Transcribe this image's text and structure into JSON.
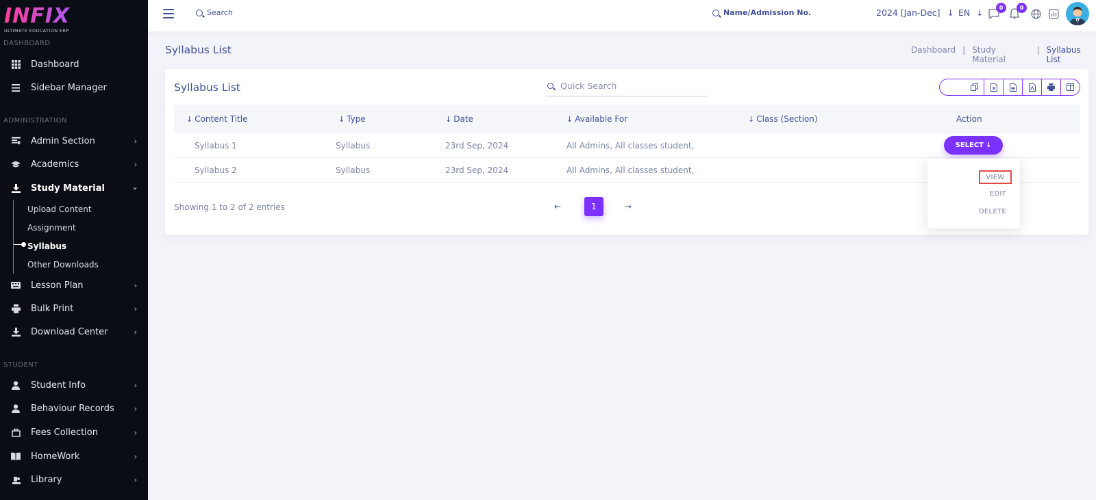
{
  "brand": {
    "logo": "INFIX",
    "tagline": "ULTIMATE EDUCATION ERP"
  },
  "sidebar": {
    "faded_label": "DASHBOARD",
    "groups": {
      "administration": "ADMINISTRATION",
      "student": "STUDENT"
    },
    "items": {
      "dashboard": "Dashboard",
      "sidebar_manager": "Sidebar Manager",
      "admin_section": "Admin Section",
      "academics": "Academics",
      "study_material": "Study Material",
      "lesson_plan": "Lesson Plan",
      "bulk_print": "Bulk Print",
      "download_center": "Download Center",
      "student_info": "Student Info",
      "behaviour_records": "Behaviour Records",
      "fees_collection": "Fees Collection",
      "homework": "HomeWork",
      "library": "Library"
    },
    "sub_items": {
      "upload_content": "Upload Content",
      "assignment": "Assignment",
      "syllabus": "Syllabus",
      "other_downloads": "Other Downloads"
    }
  },
  "topbar": {
    "search": "Search",
    "student_search": "Name/Admission No.",
    "year": "2024 [Jan-Dec]",
    "language": "EN",
    "messages_count": "0",
    "notifications_count": "0"
  },
  "page": {
    "title": "Syllabus List",
    "breadcrumb": [
      "Dashboard",
      "Study Material",
      "Syllabus List"
    ]
  },
  "card": {
    "title": "Syllabus List",
    "quick_search_placeholder": "Quick Search"
  },
  "table": {
    "headers": [
      "Content Title",
      "Type",
      "Date",
      "Available For",
      "Class (Section)",
      "Action"
    ],
    "rows": [
      {
        "title": "Syllabus 1",
        "type": "Syllabus",
        "date": "23rd Sep, 2024",
        "available_for": "All Admins, All classes student,",
        "class_section": ""
      },
      {
        "title": "Syllabus 2",
        "type": "Syllabus",
        "date": "23rd Sep, 2024",
        "available_for": "All Admins, All classes student,",
        "class_section": ""
      }
    ],
    "select_label": "SELECT",
    "showing": "Showing 1 to 2 of 2 entries",
    "current_page": "1"
  },
  "dropdown": {
    "view": "VIEW",
    "edit": "EDIT",
    "delete": "DELETE"
  },
  "colors": {
    "accent": "#7c32ff",
    "text": "#415094",
    "sidebar_bg": "#0b0d14",
    "highlight": "#e24a4a"
  }
}
